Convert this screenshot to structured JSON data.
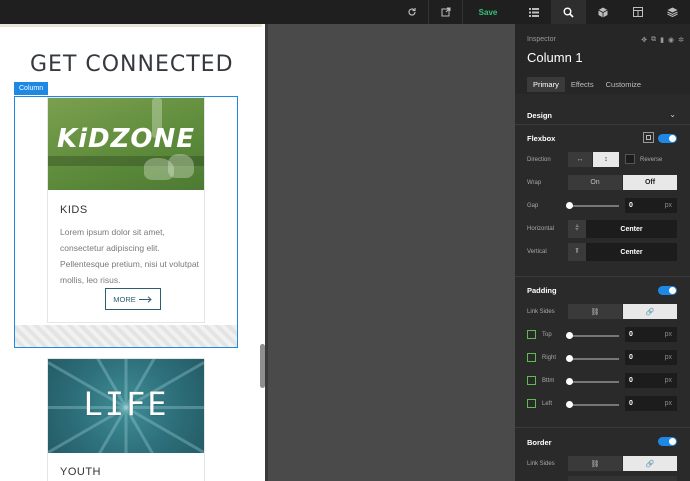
{
  "topbar": {
    "refresh_icon": "refresh-icon",
    "external_icon": "external-link-icon",
    "save_label": "Save",
    "tab_icons": [
      "list-icon",
      "search-icon",
      "cube-icon",
      "layout-icon",
      "layers-icon"
    ]
  },
  "preview": {
    "heading": "GET CONNECTED",
    "column_tag": "Column",
    "cards": [
      {
        "image_text": "KiDZONE",
        "title": "KIDS",
        "body": "Lorem ipsum dolor sit amet, consectetur adipiscing elit. Pellentesque pretium, nisi ut volutpat mollis, leo risus.",
        "button": "MORE"
      },
      {
        "image_text": "LIFE",
        "title": "YOUTH"
      }
    ]
  },
  "inspector": {
    "label": "Inspector",
    "title": "Column 1",
    "tabs": [
      "Primary",
      "Effects",
      "Customize"
    ],
    "design": {
      "label": "Design"
    },
    "flexbox": {
      "label": "Flexbox",
      "direction_label": "Direction",
      "reverse_label": "Reverse",
      "wrap_label": "Wrap",
      "wrap_on": "On",
      "wrap_off": "Off",
      "gap_label": "Gap",
      "gap_value": "0",
      "unit": "px",
      "horizontal_label": "Horizontal",
      "horizontal_value": "Center",
      "vertical_label": "Vertical",
      "vertical_value": "Center"
    },
    "padding": {
      "label": "Padding",
      "link_sides_label": "Link Sides",
      "sides": [
        {
          "label": "Top",
          "value": "0"
        },
        {
          "label": "Right",
          "value": "0"
        },
        {
          "label": "Bttm",
          "value": "0"
        },
        {
          "label": "Left",
          "value": "0"
        }
      ],
      "unit": "px"
    },
    "border": {
      "label": "Border",
      "link_sides_label": "Link Sides"
    }
  },
  "colors": {
    "accent": "#1e88e5",
    "save": "#35c27a",
    "kids_image": "#5c8a3a",
    "youth_image": "#2d6f7a"
  }
}
